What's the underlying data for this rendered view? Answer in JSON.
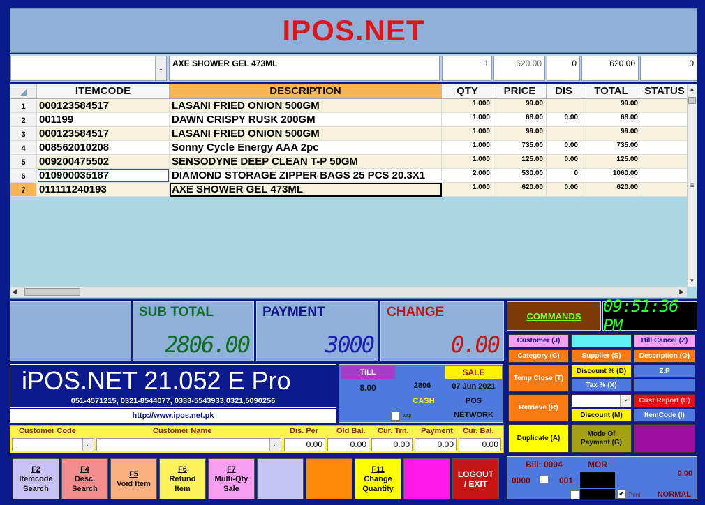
{
  "app": {
    "title": "IPOS.NET"
  },
  "entry": {
    "description": "AXE SHOWER GEL 473ML",
    "qty": "1",
    "price": "620.00",
    "dis": "0",
    "total": "620.00",
    "status": "0"
  },
  "grid": {
    "columns": [
      "ITEMCODE",
      "DESCRIPTION",
      "QTY",
      "PRICE",
      "DIS",
      "TOTAL",
      "STATUS"
    ],
    "rows": [
      {
        "n": "1",
        "code": "000123584517",
        "desc": "LASANI FRIED ONION 500GM",
        "qty": "1.000",
        "price": "99.00",
        "dis": "",
        "total": "99.00"
      },
      {
        "n": "2",
        "code": "001199",
        "desc": "DAWN CRISPY RUSK 200GM",
        "qty": "1.000",
        "price": "68.00",
        "dis": "0.00",
        "total": "68.00"
      },
      {
        "n": "3",
        "code": "000123584517",
        "desc": "LASANI FRIED ONION 500GM",
        "qty": "1.000",
        "price": "99.00",
        "dis": "",
        "total": "99.00"
      },
      {
        "n": "4",
        "code": "008562010208",
        "desc": "Sonny Cycle Energy AAA 2pc",
        "qty": "1.000",
        "price": "735.00",
        "dis": "0.00",
        "total": "735.00"
      },
      {
        "n": "5",
        "code": "009200475502",
        "desc": "SENSODYNE DEEP CLEAN T-P 50GM",
        "qty": "1.000",
        "price": "125.00",
        "dis": "0.00",
        "total": "125.00"
      },
      {
        "n": "6",
        "code": "010900035187",
        "desc": "DIAMOND STORAGE ZIPPER BAGS 25 PCS 20.3X1",
        "qty": "2.000",
        "price": "530.00",
        "dis": "0",
        "total": "1060.00"
      },
      {
        "n": "7",
        "code": "011111240193",
        "desc": "AXE SHOWER GEL 473ML",
        "qty": "1.000",
        "price": "620.00",
        "dis": "0.00",
        "total": "620.00"
      }
    ]
  },
  "totals": {
    "subtotal_label": "SUB TOTAL",
    "subtotal": "2806.00",
    "payment_label": "PAYMENT",
    "payment": "3000",
    "change_label": "CHANGE",
    "change": "0.00"
  },
  "brand": {
    "title": "iPOS.NET  21.052 E Pro",
    "phones": "051-4571215, 0321-8544077, 0333-5543933,0321,5090256",
    "url": "http://www.ipos.net.pk"
  },
  "till": {
    "till_label": "TILL",
    "till_no": "8.00",
    "sale_label": "SALE",
    "invoice": "2806",
    "date": "07 Jun 2021",
    "payment_type": "CASH",
    "mode": "POS",
    "network": "NETWORK",
    "wsp": "wsp"
  },
  "customer": {
    "code_label": "Customer Code",
    "name_label": "Customer Name",
    "dis_per_label": "Dis. Per",
    "old_bal_label": "Old Bal.",
    "cur_trn_label": "Cur. Trn.",
    "payment_label": "Payment",
    "cur_bal_label": "Cur. Bal.",
    "dis_per": "0.00",
    "old_bal": "0.00",
    "cur_trn": "0.00",
    "payment": "0.00",
    "cur_bal": "0.00"
  },
  "fkeys": [
    {
      "key": "F2",
      "line1": "Itemcode",
      "line2": "Search",
      "color": "#c9c2f7"
    },
    {
      "key": "F4",
      "line1": "Desc.",
      "line2": "Search",
      "color": "#f28b8b"
    },
    {
      "key": "F5",
      "line1": "Void Item",
      "line2": "",
      "color": "#f9b07e"
    },
    {
      "key": "F6",
      "line1": "Refund",
      "line2": "Item",
      "color": "#fff25a"
    },
    {
      "key": "F7",
      "line1": "Multi-Qty",
      "line2": "Sale",
      "color": "#f59ef2"
    },
    {
      "key": "",
      "line1": "",
      "line2": "",
      "color": "#c4c4f4"
    },
    {
      "key": "",
      "line1": "",
      "line2": "",
      "color": "#ff8a0a"
    },
    {
      "key": "F11",
      "line1": "Change",
      "line2": "Quantity",
      "color": "#ffff00"
    },
    {
      "key": "",
      "line1": "",
      "line2": "",
      "color": "#ff18e8"
    },
    {
      "key": "",
      "line1": "LOGOUT",
      "line2": "/ EXIT",
      "color": "#c81616"
    }
  ],
  "commands": {
    "header": "COMMANDS",
    "clock": "09:51:36 PM",
    "customer": "Customer (J)",
    "bill_cancel": "Bill Cancel (Z)",
    "category": "Category (C)",
    "supplier": "Supplier (S)",
    "description": "Description (O)",
    "temp_close": "Temp Close (T)",
    "discount_pct": "Discount % (D)",
    "zp": "Z.P",
    "tax_pct": "Tax % (X)",
    "retrieve": "Retrieve (R)",
    "cust_report": "Cust Report (E)",
    "discount_m": "Discount (M)",
    "itemcode": "ItemCode (I)",
    "duplicate": "Duplicate (A)",
    "mode_of_payment": "Mode Of Payment (G)"
  },
  "bill": {
    "bill_label": "Bill: 0004",
    "user": "MOR",
    "left_code": "0000",
    "mid_code": "001",
    "amount": "0.00",
    "print": "Print",
    "mode": "NORMAL"
  }
}
